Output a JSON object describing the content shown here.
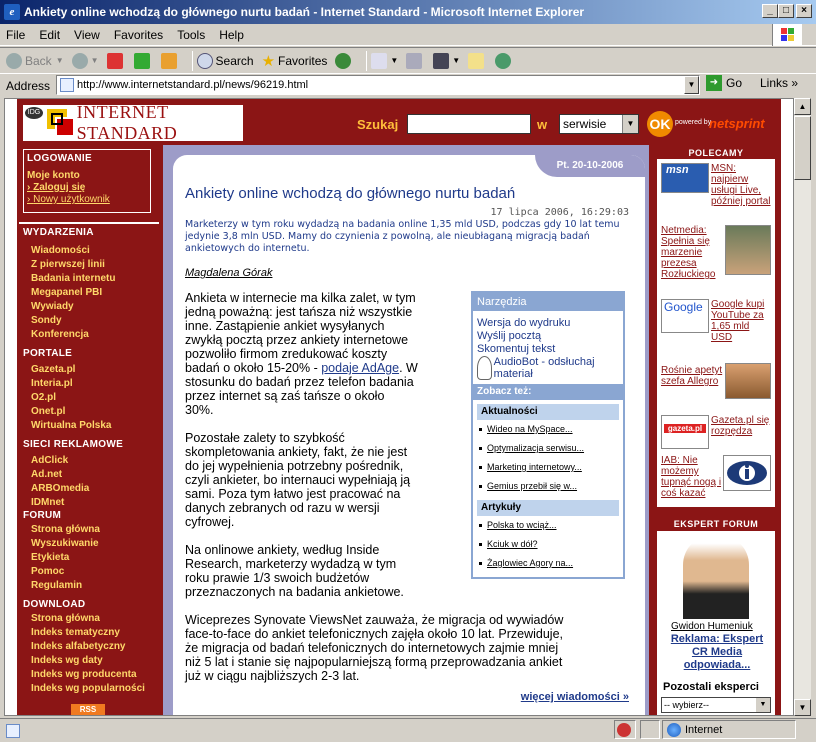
{
  "window": {
    "title": "Ankiety online wchodzą do głównego nurtu badań - Internet Standard - Microsoft Internet Explorer"
  },
  "menu": [
    "File",
    "Edit",
    "View",
    "Favorites",
    "Tools",
    "Help"
  ],
  "toolbar": {
    "back": "Back",
    "search": "Search",
    "favorites": "Favorites"
  },
  "address": {
    "label": "Address",
    "url": "http://www.internetstandard.pl/news/96219.html",
    "go": "Go",
    "links": "Links"
  },
  "site": {
    "logo": "INTERNET STANDARD",
    "idg": "IDG",
    "search_label": "Szukaj",
    "in_label": "w",
    "scope": "serwisie",
    "ok": "OK",
    "powered": "powered by",
    "netsprint": "netsprint"
  },
  "leftnav": {
    "login": {
      "title": "LOGOWANIE",
      "account": "Moje konto",
      "items": [
        "Zaloguj się",
        "Nowy użytkownik"
      ]
    },
    "sections": [
      {
        "title": "WYDARZENIA",
        "items": [
          "Wiadomości",
          "Z pierwszej linii",
          "Badania internetu",
          "Megapanel PBI",
          "Wywiady",
          "Sondy",
          "Konferencja"
        ]
      },
      {
        "title": "PORTALE",
        "items": [
          "Gazeta.pl",
          "Interia.pl",
          "O2.pl",
          "Onet.pl",
          "Wirtualna Polska"
        ]
      },
      {
        "title": "SIECI REKLAMOWE",
        "items": [
          "AdClick",
          "Ad.net",
          "ARBOmedia",
          "IDMnet"
        ]
      },
      {
        "title": "FORUM",
        "items": [
          "Strona główna",
          "Wyszukiwanie",
          "Etykieta",
          "Pomoc",
          "Regulamin"
        ]
      },
      {
        "title": "DOWNLOAD",
        "items": [
          "Strona główna",
          "Indeks tematyczny",
          "Indeks alfabetyczny",
          "Indeks wg daty",
          "Indeks wg producenta",
          "Indeks wg popularności"
        ]
      }
    ],
    "rss": "RSS"
  },
  "article": {
    "date_badge": "Pt.   20-10-2006",
    "title": "Ankiety online wchodzą do głównego nurtu badań",
    "timestamp": "17 lipca 2006, 16:29:03",
    "lead": "Marketerzy w tym roku wydadzą na badania online 1,35 mld USD, podczas gdy 10 lat temu jedynie 3,8 mln USD. Mamy do czynienia z powolną, ale nieubłaganą migracją badań ankietowych do internetu.",
    "author": "Magdalena Górak",
    "p1_lines": [
      "Ankieta w internecie ma kilka zalet, w tym",
      "jedną poważną: jest tańsza niż wszystkie",
      "inne. Zastąpienie ankiet wysyłanych",
      "zwykłą pocztą przez ankiety internetowe",
      "pozwoliło firmom zredukować koszty"
    ],
    "p1_pre": "badań o około 15-20% - ",
    "p1_link": "podaje AdAge",
    "p1_post": ". W",
    "p1_rest": [
      "stosunku do badań przez telefon badania",
      "przez internet są zaś tańsze o około",
      "30%."
    ],
    "p2_lines": [
      "Pozostałe zalety to szybkość",
      "skompletowania ankiety, fakt, że nie jest",
      "do jej wypełnienia potrzebny pośrednik,",
      "czyli ankieter, bo internauci wypełniają ją",
      "sami. Poza tym łatwo jest pracować na",
      "danych zebranych od razu w wersji",
      "cyfrowej."
    ],
    "p3_lines": [
      "Na onlinowe ankiety, według Inside",
      "Research, marketerzy wydadzą w tym",
      "roku prawie 1/3 swoich budżetów",
      "przeznaczonych na badania ankietowe."
    ],
    "p4_lines": [
      "Wiceprezes Synovate ViewsNet zauważa, że migracja od wywiadów",
      "face-to-face do ankiet telefonicznych zajęła około 10 lat. Przewiduje,",
      "że migracja od badań telefonicznych do internetowych zajmie mniej",
      "niż 5 lat i stanie się najpopularniejszą formą przeprowadzania ankiet",
      "już w ciągu najbliższych 2-3 lat."
    ],
    "more": "więcej wiadomości »"
  },
  "tools": {
    "title": "Narzędzia",
    "links": [
      "Wersja do wydruku",
      "Wyślij pocztą",
      "Skomentuj tekst"
    ],
    "audiobot": "AudioBot - odsłuchaj materiał",
    "see_also": "Zobacz też:",
    "sections": [
      {
        "title": "Aktualności",
        "items": [
          "Wideo na MySpace...",
          "Optymalizacja serwisu...",
          "Marketing internetowy...",
          "Gemius przebił się w..."
        ]
      },
      {
        "title": "Artykuły",
        "items": [
          "Polska to wciąż...",
          "Kciuk w dół?",
          "Żaglowiec Agory na..."
        ]
      }
    ]
  },
  "right": {
    "polecamy": "POLECAMY",
    "items": [
      {
        "text": "MSN: najpierw usługi Live, później portal",
        "badge": "msn"
      },
      {
        "text": "Netmedia: Spełnia się marzenie prezesa Rozłuckiego"
      },
      {
        "text": "Google kupi YouTube za 1,65 mld USD",
        "badge": "Google"
      },
      {
        "text": "Rośnie apetyt szefa Allegro"
      },
      {
        "text": "Gazeta.pl się rozpędza",
        "badge": "gazeta.pl"
      },
      {
        "text": "IAB: Nie możemy tupnąć nogą i coś kazać"
      }
    ],
    "ekspert_title": "EKSPERT FORUM",
    "ekspert_name": "Gwidon Humeniuk",
    "ekspert_role": "Reklama: Ekspert CR Media odpowiada...",
    "others": "Pozostali eksperci",
    "choose": "-- wybierz--"
  },
  "status": {
    "zone": "Internet"
  }
}
